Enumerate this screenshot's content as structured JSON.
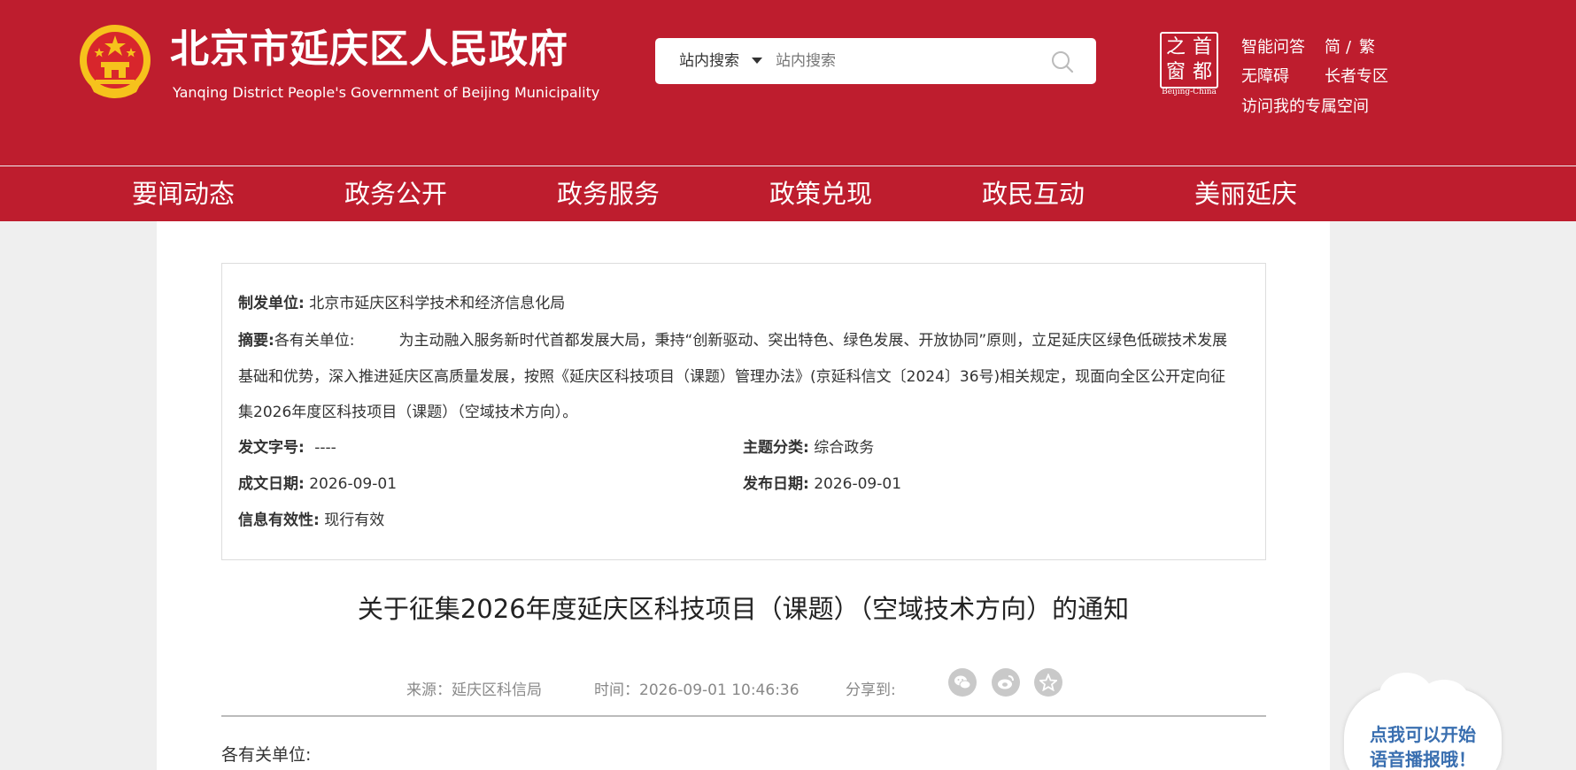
{
  "header": {
    "title": "北京市延庆区人民政府",
    "subtitle": "Yanqing District People's Government of Beijing Municipality",
    "search": {
      "scope_label": "站内搜索",
      "placeholder": "站内搜索"
    },
    "capital_logo": {
      "chars": [
        "之",
        "首",
        "窗",
        "都"
      ],
      "caption": "Beijing-China"
    },
    "links": {
      "smart_qa": "智能问答",
      "simplified": "简",
      "separator": "/",
      "traditional": "繁",
      "accessibility": "无障碍",
      "elderly": "长者专区",
      "personal_space": "访问我的专属空间"
    }
  },
  "nav": {
    "items": [
      "要闻动态",
      "政务公开",
      "政务服务",
      "政策兑现",
      "政民互动",
      "美丽延庆"
    ]
  },
  "meta": {
    "issuer_label": "制发单位:",
    "issuer": "北京市延庆区科学技术和经济信息化局",
    "summary_label": "摘要:",
    "summary_lead": "各有关单位:",
    "summary_text": "为主动融入服务新时代首都发展大局，秉持“创新驱动、突出特色、绿色发展、开放协同”原则，立足延庆区绿色低碳技术发展基础和优势，深入推进延庆区高质量发展，按照《延庆区科技项目（课题）管理办法》(京延科信文〔2024〕36号)相关规定，现面向全区公开定向征集2026年度区科技项目（课题）（空域技术方向）。",
    "doc_no_label": "发文字号:",
    "doc_no": "----",
    "topic_label": "主题分类:",
    "topic": "综合政务",
    "written_date_label": "成文日期:",
    "written_date": "2026-09-01",
    "publish_date_label": "发布日期:",
    "publish_date": "2026-09-01",
    "validity_label": "信息有效性:",
    "validity": "现行有效"
  },
  "article": {
    "title": "关于征集2026年度延庆区科技项目（课题）（空域技术方向）的通知",
    "source": "来源：延庆区科信局",
    "time": "时间：2026-09-01 10:46:36",
    "share_label": "分享到:",
    "share_icons": [
      "wechat-icon",
      "weibo-icon",
      "star-icon"
    ],
    "body_start": "各有关单位:"
  },
  "tts": {
    "line1": "点我可以开始",
    "line2": "语音播报哦！"
  },
  "colors": {
    "brand_red": "#be1d2e",
    "tts_blue": "#3a6fb0"
  }
}
